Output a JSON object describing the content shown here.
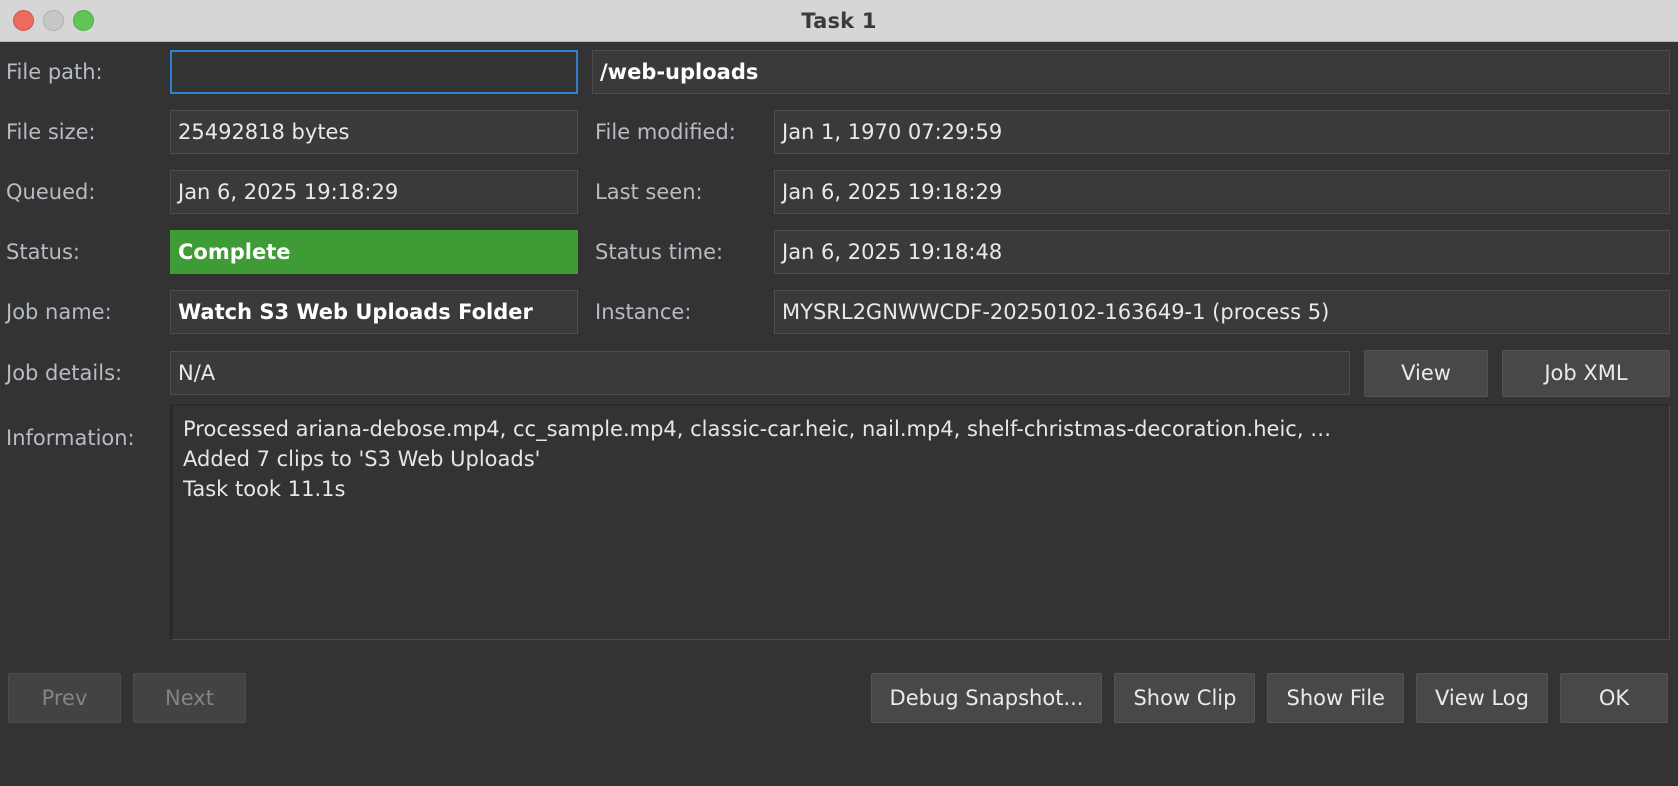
{
  "window": {
    "title": "Task 1",
    "traffic_lights": [
      "close-button",
      "minimize-button",
      "maximize-button"
    ],
    "accent_focus": "#2f7fd0",
    "status_color": "#3f9b35",
    "titlebar_bg": "#d6d6d6",
    "body_bg": "#333333"
  },
  "fields": {
    "file_path_label": "File path:",
    "file_path_value": "",
    "file_path_placeholder": "",
    "file_name_value": "/web-uploads",
    "file_size_label": "File size:",
    "file_size_value": "25492818 bytes",
    "file_modified_label": "File modified:",
    "file_modified_value": "Jan 1, 1970 07:29:59",
    "queued_label": "Queued:",
    "queued_value": "Jan 6, 2025 19:18:29",
    "last_seen_label": "Last seen:",
    "last_seen_value": "Jan 6, 2025 19:18:29",
    "status_label": "Status:",
    "status_value": "Complete",
    "status_time_label": "Status time:",
    "status_time_value": "Jan 6, 2025 19:18:48",
    "job_name_label": "Job name:",
    "job_name_value": "Watch S3 Web Uploads Folder",
    "instance_label": "Instance:",
    "instance_value": "MYSRL2GNWWCDF-20250102-163649-1 (process 5)",
    "job_details_label": "Job details:",
    "job_details_value": "N/A",
    "information_label": "Information:"
  },
  "information_lines": [
    "Processed ariana-debose.mp4, cc_sample.mp4, classic-car.heic, nail.mp4, shelf-christmas-decoration.heic, …",
    "Added 7 clips to 'S3 Web Uploads'",
    "Task took 11.1s"
  ],
  "buttons": {
    "view": "View",
    "job_xml": "Job XML",
    "prev": "Prev",
    "next": "Next",
    "debug_snapshot": "Debug Snapshot...",
    "show_clip": "Show Clip",
    "show_file": "Show File",
    "view_log": "View Log",
    "ok": "OK"
  }
}
